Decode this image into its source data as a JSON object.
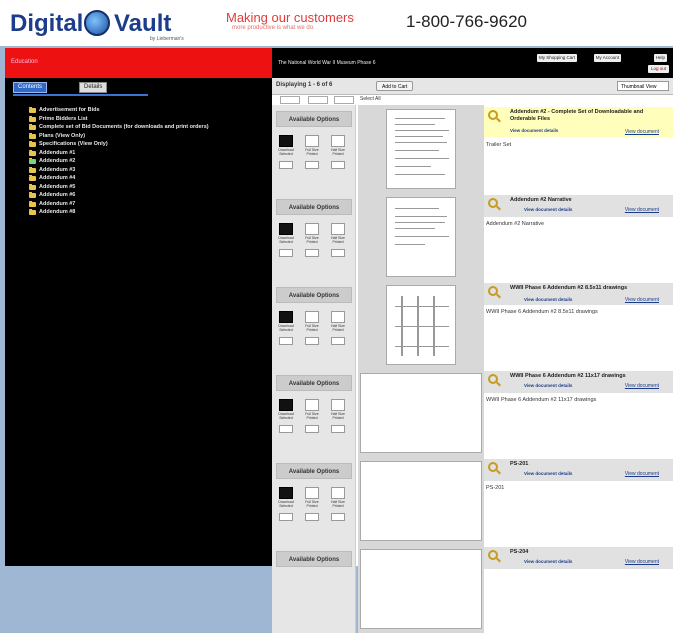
{
  "header": {
    "logo_left": "Digital",
    "logo_right": "Vault",
    "logo_sub": "by Lieberman's",
    "tagline_main": "Making our customers",
    "tagline_sub": "more productive is what we do.",
    "phone": "1-800-766-9620"
  },
  "left": {
    "redbar_text": "Education",
    "tabs": [
      "Contents",
      "Details"
    ],
    "tree": [
      "Advertisement for Bids",
      "Prime Bidders List",
      "Complete set of Bid Documents (for downloads and print orders)",
      "Plans (View Only)",
      "Specifications (View Only)",
      "Addendum #1",
      "Addendum #2",
      "Addendum #3",
      "Addendum #4",
      "Addendum #5",
      "Addendum #6",
      "Addendum #7",
      "Addendum #8"
    ]
  },
  "right": {
    "project_title": "The National World War II Museum Phase 6",
    "top_links": [
      "My Shopping Cart",
      "My Account",
      "Help"
    ],
    "logout": "Log out",
    "displaying": "Displaying 1 - 6 of 6",
    "add_to_cart": "Add to Cart",
    "view_select": "Thumbnail View",
    "select_all": "Select All",
    "available_options": "Available Options",
    "option_labels": [
      "Download Selected",
      "Full Size Printed",
      "Half Size Printed"
    ],
    "view_document": "View document",
    "document_details": "View document details",
    "items": [
      {
        "title": "Addendum #2 - Complete Set of Downloadable and Orderable Files",
        "desc": "Trailer Set"
      },
      {
        "title": "Addendum #2 Narrative",
        "desc": "Addendum #2 Narrative"
      },
      {
        "title": "WWII Phase 6 Addendum #2 8.5x11 drawings",
        "desc": "WWII Phase 6 Addendum #2 8.5x11 drawings"
      },
      {
        "title": "WWII Phase 6 Addendum #2 11x17 drawings",
        "desc": "WWII Phase 6 Addendum #2 11x17 drawings"
      },
      {
        "title": "PS-201",
        "desc": "PS-201"
      },
      {
        "title": "PS-204",
        "desc": ""
      }
    ]
  }
}
